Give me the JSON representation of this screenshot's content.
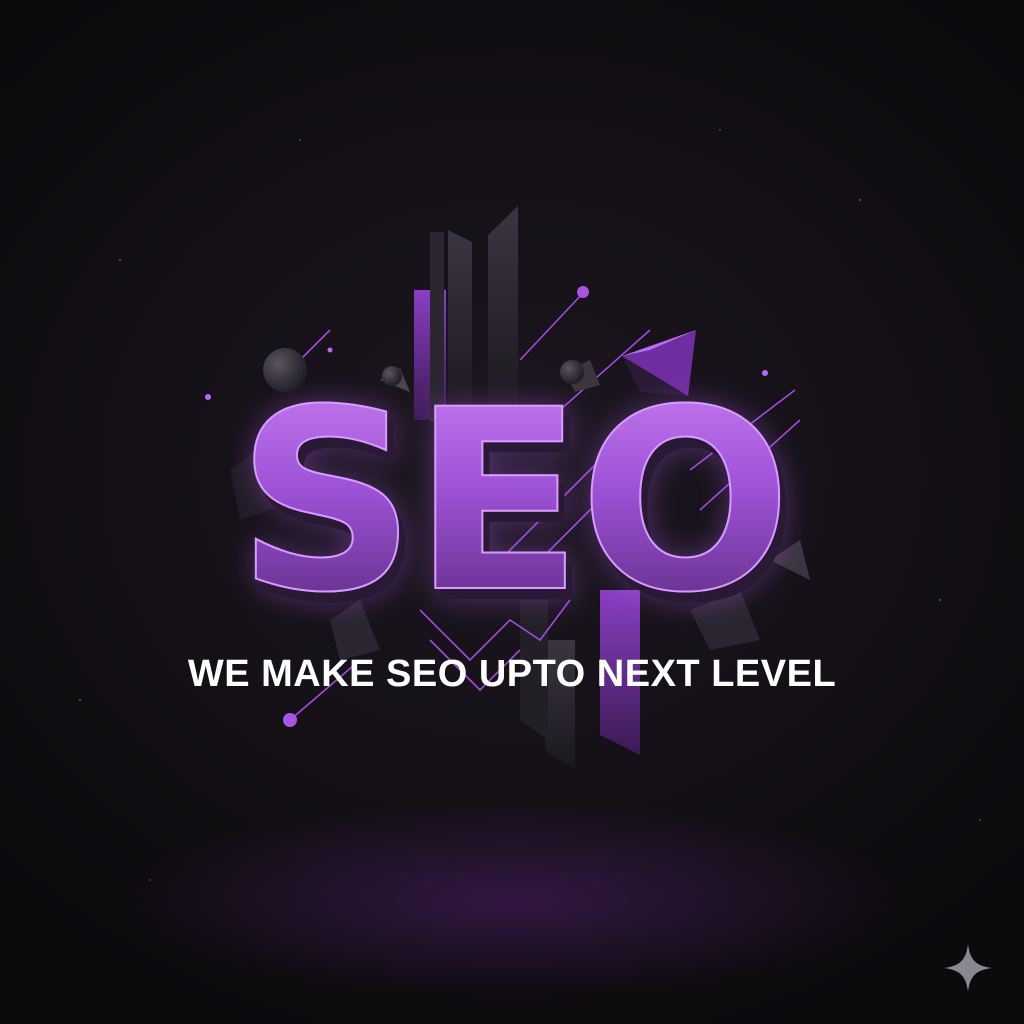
{
  "poster": {
    "headline": "SEO",
    "tagline": "WE MAKE SEO UPTO NEXT LEVEL"
  },
  "colors": {
    "background": "#120e14",
    "accent_purple": "#a855e6",
    "accent_light": "#d79bff",
    "text": "#ffffff",
    "sparkle": "#8a8790"
  },
  "icons": {
    "watermark": "sparkle-icon"
  }
}
